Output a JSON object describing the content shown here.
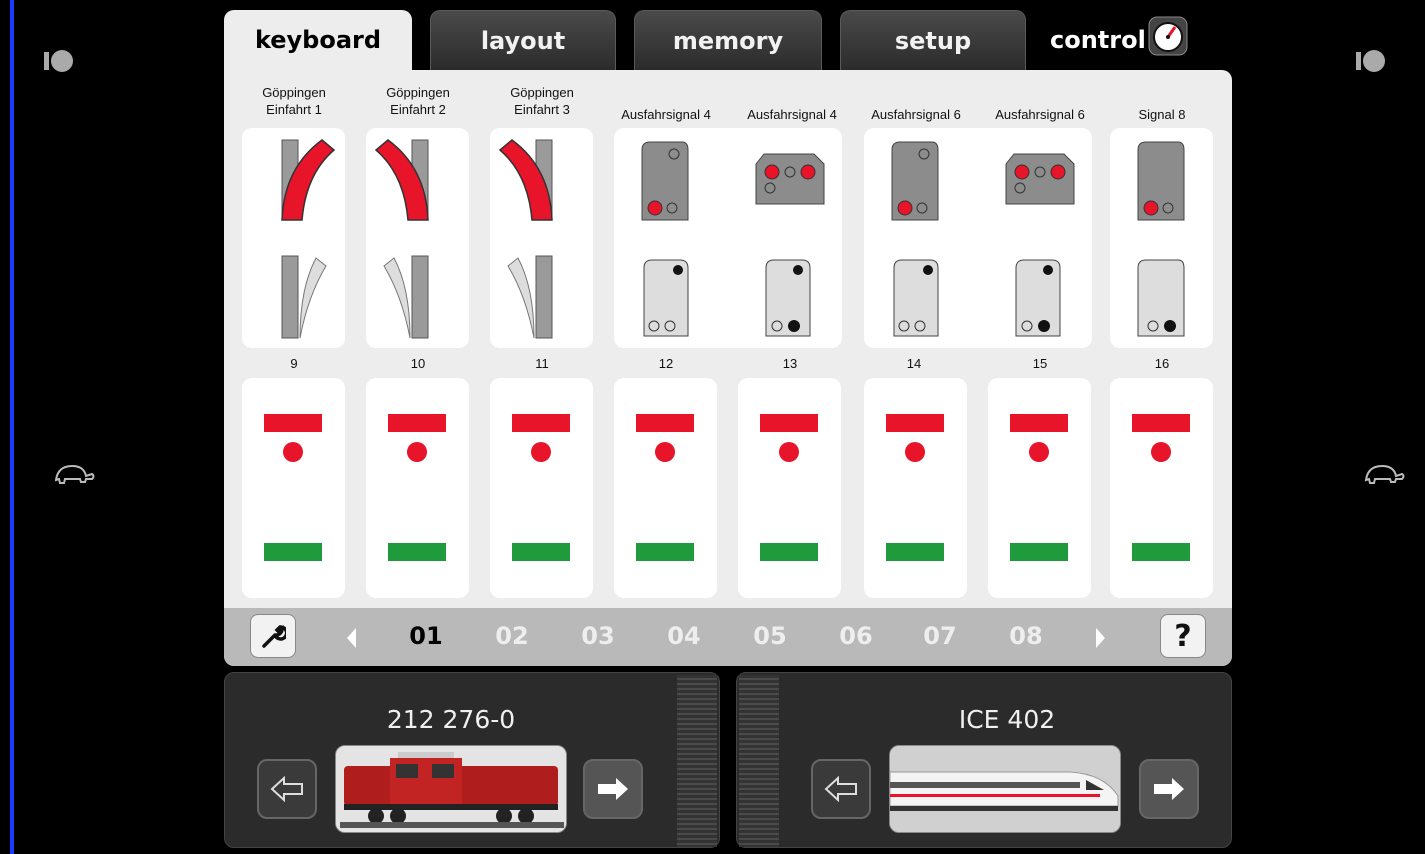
{
  "tabs": [
    {
      "label": "keyboard",
      "active": true
    },
    {
      "label": "layout",
      "active": false
    },
    {
      "label": "memory",
      "active": false
    },
    {
      "label": "setup",
      "active": false
    },
    {
      "label": "control",
      "active": false
    }
  ],
  "keyboard": {
    "top_row": [
      {
        "label": "Göppingen\nEinfahrt 1",
        "type": "turnout-right"
      },
      {
        "label": "Göppingen\nEinfahrt 2",
        "type": "turnout-left"
      },
      {
        "label": "Göppingen\nEinfahrt 3",
        "type": "turnout-left"
      },
      {
        "label": "Ausfahrsignal 4",
        "type": "signal-main"
      },
      {
        "label": "Ausfahrsignal 4",
        "type": "signal-dwarf"
      },
      {
        "label": "Ausfahrsignal 6",
        "type": "signal-main"
      },
      {
        "label": "Ausfahrsignal 6",
        "type": "signal-dwarf"
      },
      {
        "label": "Signal 8",
        "type": "signal-main"
      }
    ],
    "bottom_row": [
      {
        "number": "9"
      },
      {
        "number": "10"
      },
      {
        "number": "11"
      },
      {
        "number": "12"
      },
      {
        "number": "13"
      },
      {
        "number": "14"
      },
      {
        "number": "15"
      },
      {
        "number": "16"
      }
    ],
    "pages": [
      "01",
      "02",
      "03",
      "04",
      "05",
      "06",
      "07",
      "08"
    ],
    "current_page": "01",
    "help_label": "?"
  },
  "locos": [
    {
      "name": "212 276-0",
      "image": "red-diesel-locomotive"
    },
    {
      "name": "ICE 402",
      "image": "ice-high-speed-train"
    }
  ],
  "colors": {
    "red": "#e8142a",
    "green": "#1f9a3c",
    "panel": "#ededed"
  }
}
